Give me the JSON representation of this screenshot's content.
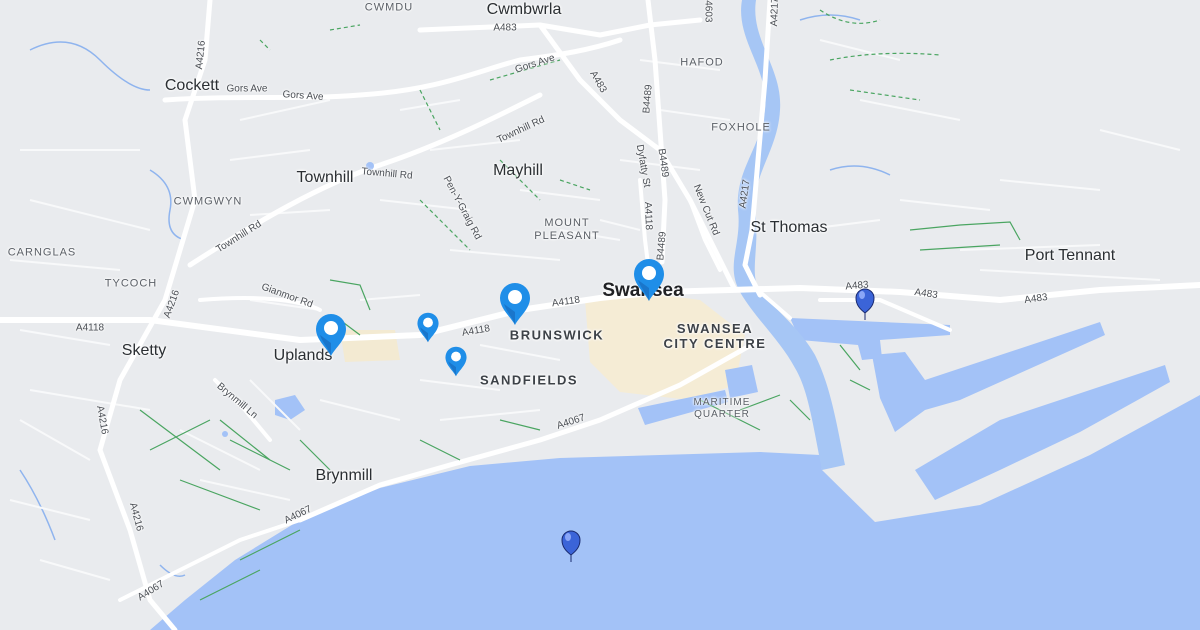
{
  "colors": {
    "land": "#e9ebee",
    "water": "#a3c2f7",
    "river": "#a6c6f5",
    "road": "#ffffff",
    "path": "#4aa561",
    "urban": "#f5ecd5",
    "pin_primary": "#1f8ee8",
    "pin_secondary": "#3b64d8"
  },
  "places": {
    "cwmdu": "CWMDU",
    "cwmbwrla": "Cwmbwrla",
    "cockett": "Cockett",
    "hafod": "HAFOD",
    "foxhole": "FOXHOLE",
    "townhill": "Townhill",
    "mayhill": "Mayhill",
    "cwmgwyn": "CWMGWYN",
    "carnglas": "CARNGLAS",
    "tycoch": "TYCOCH",
    "st_thomas": "St Thomas",
    "port_tennant": "Port Tennant",
    "mount_pleasant": "MOUNT PLEASANT",
    "swansea": "Swansea",
    "brunswick": "BRUNSWICK",
    "swansea_city_centre": "SWANSEA CITY CENTRE",
    "sketty": "Sketty",
    "uplands": "Uplands",
    "sandfields": "SANDFIELDS",
    "maritime_quarter": "MARITIME QUARTER",
    "brynmill": "Brynmill"
  },
  "roads": {
    "a483_n": "A483",
    "a483_w": "A483",
    "a4603": "A4603",
    "a4217_n": "A4217",
    "a4216_n": "A4216",
    "gors_ave_w": "Gors Ave",
    "gors_ave_mid": "Gors Ave",
    "gors_ave_e": "Gors Ave",
    "b4489_n": "B4489",
    "townhill_rd_e": "Townhill Rd",
    "townhill_rd_mid": "Townhill Rd",
    "pen_y_graig_rd": "Pen-Y-Graig Rd",
    "dyfatty_st": "Dyfatty St",
    "b4489_s": "B4489",
    "a4118_n": "A4118",
    "new_cut_rd": "New Cut Rd",
    "a4217_s": "A4217",
    "townhill_rd_w": "Townhill Rd",
    "b4489_c": "B4489",
    "gianmor_rd": "Gianmor Rd",
    "a4216_w": "A4216",
    "a4118_e": "A4118",
    "a4118_mid": "A4118",
    "a4118_w": "A4118",
    "a483_e1": "A483",
    "a483_e2": "A483",
    "a483_e3": "A483",
    "brynmill_ln": "Brynmill Ln",
    "a4067_e": "A4067",
    "a4216_s": "A4216",
    "a4216_sw": "A4216",
    "a4067_mid": "A4067",
    "a4067_sw": "A4067"
  },
  "markers": [
    {
      "name": "marker-uplands",
      "style": "primary",
      "size": "large"
    },
    {
      "name": "marker-brunswick-west",
      "style": "primary",
      "size": "small"
    },
    {
      "name": "marker-sandfields",
      "style": "primary",
      "size": "small"
    },
    {
      "name": "marker-brunswick",
      "style": "primary",
      "size": "large"
    },
    {
      "name": "marker-swansea-centre",
      "style": "primary",
      "size": "large"
    },
    {
      "name": "marker-docks",
      "style": "secondary",
      "size": "small"
    },
    {
      "name": "marker-bay",
      "style": "secondary",
      "size": "small"
    }
  ]
}
